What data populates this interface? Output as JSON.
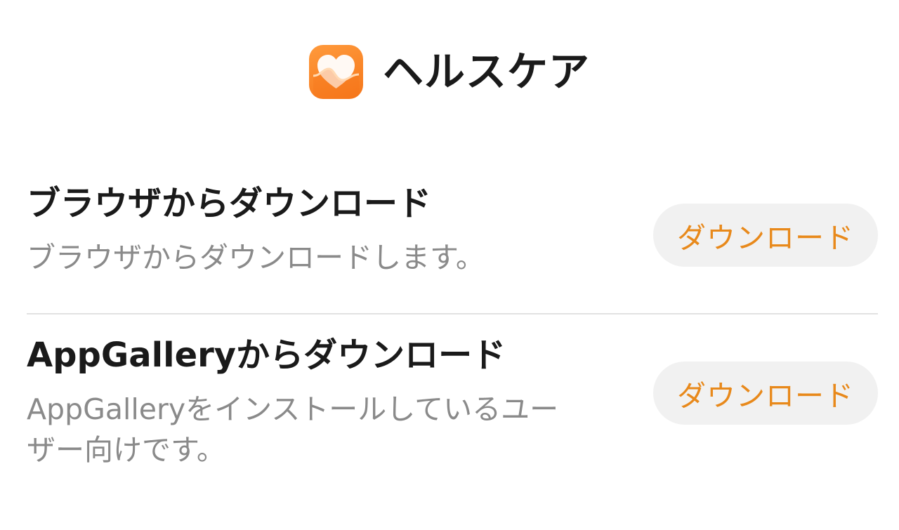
{
  "app": {
    "title": "ヘルスケア",
    "icon": "health-heart-icon",
    "accent_color": "#F5761A"
  },
  "options": [
    {
      "title": "ブラウザからダウンロード",
      "description": "ブラウザからダウンロードします。",
      "button_label": "ダウンロード"
    },
    {
      "title": "AppGalleryからダウンロード",
      "description": "AppGalleryをインストールしているユーザー向けです。",
      "button_label": "ダウンロード"
    }
  ],
  "colors": {
    "button_text": "#E8891B",
    "button_background": "#F1F1F1",
    "description_text": "#8A8A8A"
  }
}
